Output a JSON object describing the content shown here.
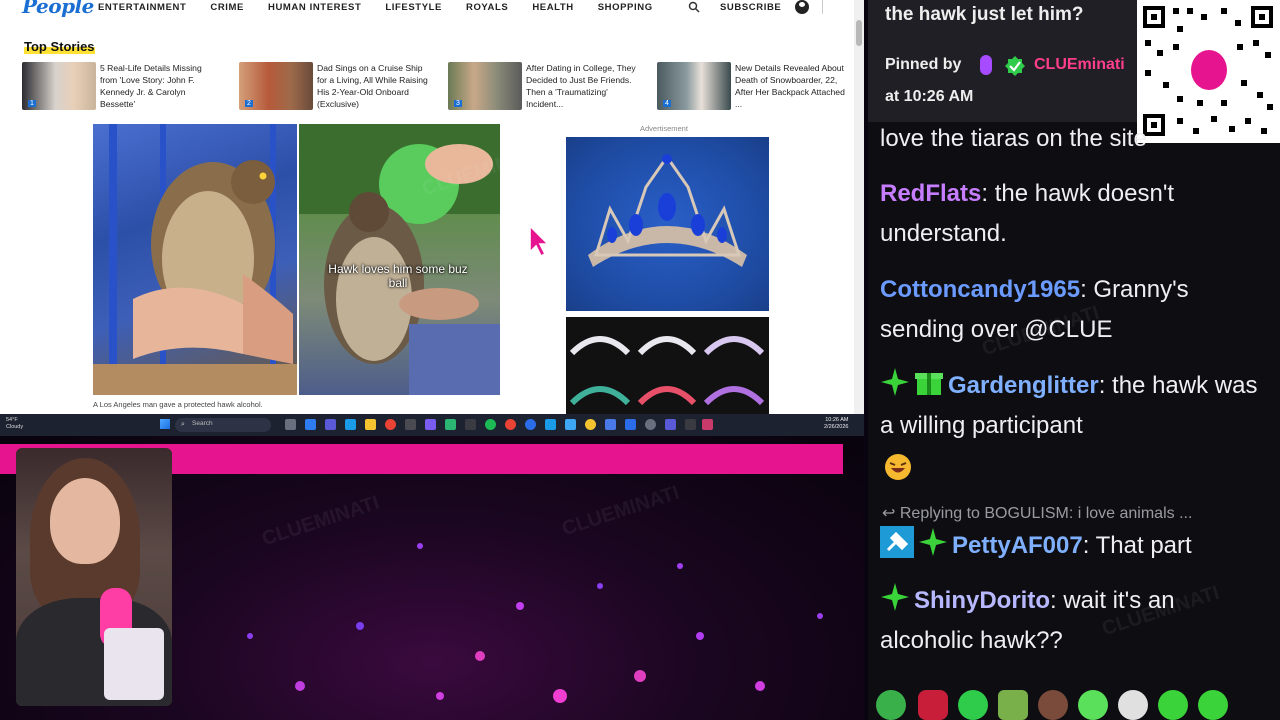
{
  "site": {
    "logo": "People",
    "nav": [
      "ENTERTAINMENT",
      "CRIME",
      "HUMAN INTEREST",
      "LIFESTYLE",
      "ROYALS",
      "HEALTH",
      "SHOPPING"
    ],
    "subscribe": "SUBSCRIBE"
  },
  "top_stories": {
    "label": "Top Stories",
    "items": [
      {
        "num": "1",
        "title": "5 Real-Life Details Missing from 'Love Story: John F. Kennedy Jr. & Carolyn Bessette'"
      },
      {
        "num": "2",
        "title": "Dad Sings on a Cruise Ship for a Living, All While Raising His 2-Year-Old Onboard (Exclusive)"
      },
      {
        "num": "3",
        "title": "After Dating in College, They Decided to Just Be Friends. Then a 'Traumatizing' Incident..."
      },
      {
        "num": "4",
        "title": "New Details Revealed About Death of Snowboarder, 22, After Her Backpack Attached ..."
      }
    ]
  },
  "article": {
    "overlay_text": "Hawk loves him some buz ball",
    "photo_caption": "A Los Angeles man gave a protected hawk alcohol.",
    "ad_label": "Advertisement"
  },
  "taskbar": {
    "weather_temp": "54°F",
    "weather_desc": "Cloudy",
    "search_label": "Search",
    "time": "10:26 AM",
    "date": "2/26/2026"
  },
  "chat": {
    "pinned_text": "the hawk just let him?",
    "pinned_by_label": "Pinned by",
    "pinned_user": "CLUEminati",
    "pinned_time": "at 10:26 AM",
    "messages": [
      {
        "user": "",
        "text": "love the tiaras on the site",
        "color": "#efeff1"
      },
      {
        "user": "RedFlats",
        "text": ": the hawk doesn't understand.",
        "color": "#c77dff"
      },
      {
        "user": "Cottoncandy1965",
        "text": ": Granny's sending over @CLUE",
        "color": "#6b9bff"
      },
      {
        "user": "Gardenglitter",
        "text": ": the hawk was a willing participant",
        "color": "#7fb0ff"
      },
      {
        "user": "PettyAF007",
        "text": ": That part",
        "color": "#7fb0ff"
      },
      {
        "user": "ShinyDorito",
        "text": ": wait it's an alcoholic hawk??",
        "color": "#b8b8ff"
      }
    ],
    "reply_context": "Replying to BOGULISM: i love animals ..."
  },
  "watermark_text": "CLUEMINATI",
  "colors": {
    "brand_pink": "#e6158f",
    "people_blue": "#1b6fd3",
    "highlight_yellow": "#ffe135"
  }
}
